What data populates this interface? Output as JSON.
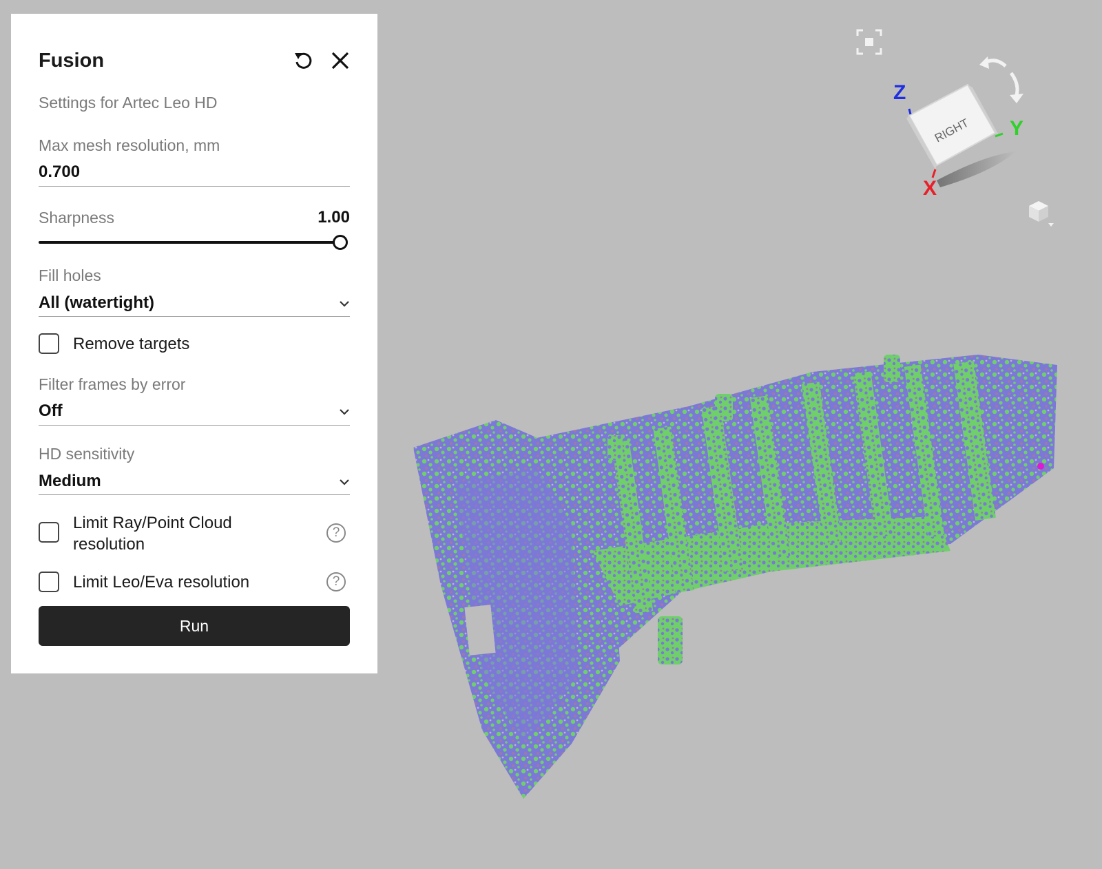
{
  "panel": {
    "title": "Fusion",
    "subtitle": "Settings for Artec Leo HD",
    "max_mesh": {
      "label": "Max mesh resolution, mm",
      "value": "0.700"
    },
    "sharpness": {
      "label": "Sharpness",
      "value": "1.00",
      "level": 1.0
    },
    "fill_holes": {
      "label": "Fill holes",
      "value": "All (watertight)"
    },
    "remove_targets": {
      "label": "Remove targets",
      "checked": false
    },
    "filter_frames": {
      "label": "Filter frames by error",
      "value": "Off"
    },
    "hd_sensitivity": {
      "label": "HD sensitivity",
      "value": "Medium"
    },
    "limit_ray": {
      "label_line1": "Limit Ray/Point Cloud",
      "label_line2": "resolution",
      "checked": false,
      "help": "?"
    },
    "limit_leo": {
      "label": "Limit Leo/Eva resolution",
      "checked": false,
      "help": "?"
    },
    "run_label": "Run"
  },
  "gizmo": {
    "face_label": "RIGHT",
    "axis_x": "X",
    "axis_y": "Y",
    "axis_z": "Z",
    "colors": {
      "x": "#e8202a",
      "y": "#2fd12a",
      "z": "#1f2fe0"
    }
  },
  "icons": [
    "reset-icon",
    "close-icon",
    "fit-view-icon",
    "rotate-left-icon",
    "rotate-right-icon",
    "view-cube-menu-icon",
    "chevron-down-icon",
    "help-icon"
  ],
  "colors": {
    "viewport_bg": "#bdbdbd",
    "model_blue": "#7b78d8",
    "model_green": "#6fcf6a",
    "run_bg": "#252525"
  }
}
